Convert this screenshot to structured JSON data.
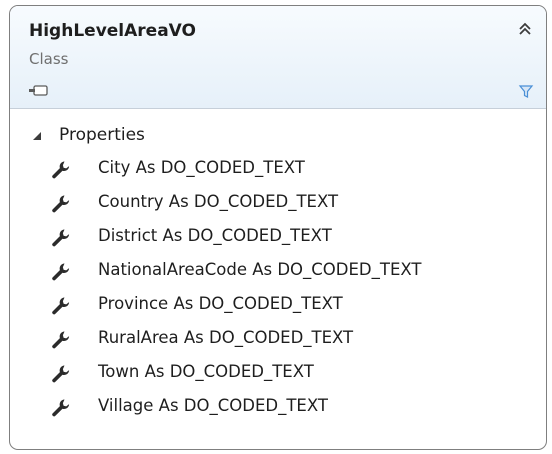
{
  "class": {
    "name": "HighLevelAreaVO",
    "stereotype": "Class",
    "icon": "class-icon",
    "collapse_icon": "double-chevron-up-icon",
    "filter_icon": "filter-icon"
  },
  "sections": [
    {
      "label": "Properties",
      "expanded": true,
      "expander_icon": "triangle-expanded-icon",
      "members": [
        {
          "label": "City As DO_CODED_TEXT",
          "icon": "wrench-icon"
        },
        {
          "label": "Country As DO_CODED_TEXT",
          "icon": "wrench-icon"
        },
        {
          "label": "District As DO_CODED_TEXT",
          "icon": "wrench-icon"
        },
        {
          "label": "NationalAreaCode As DO_CODED_TEXT",
          "icon": "wrench-icon"
        },
        {
          "label": "Province As DO_CODED_TEXT",
          "icon": "wrench-icon"
        },
        {
          "label": "RuralArea As DO_CODED_TEXT",
          "icon": "wrench-icon"
        },
        {
          "label": "Town As DO_CODED_TEXT",
          "icon": "wrench-icon"
        },
        {
          "label": "Village As DO_CODED_TEXT",
          "icon": "wrench-icon"
        }
      ]
    }
  ],
  "colors": {
    "border": "#7f7f7f",
    "header_top": "#f7fbfe",
    "header_bottom": "#e6f0f9",
    "text": "#1e1e1e",
    "muted_text": "#6f6f6f",
    "icon": "#2b2b2b",
    "filter": "#4a8fd6"
  }
}
